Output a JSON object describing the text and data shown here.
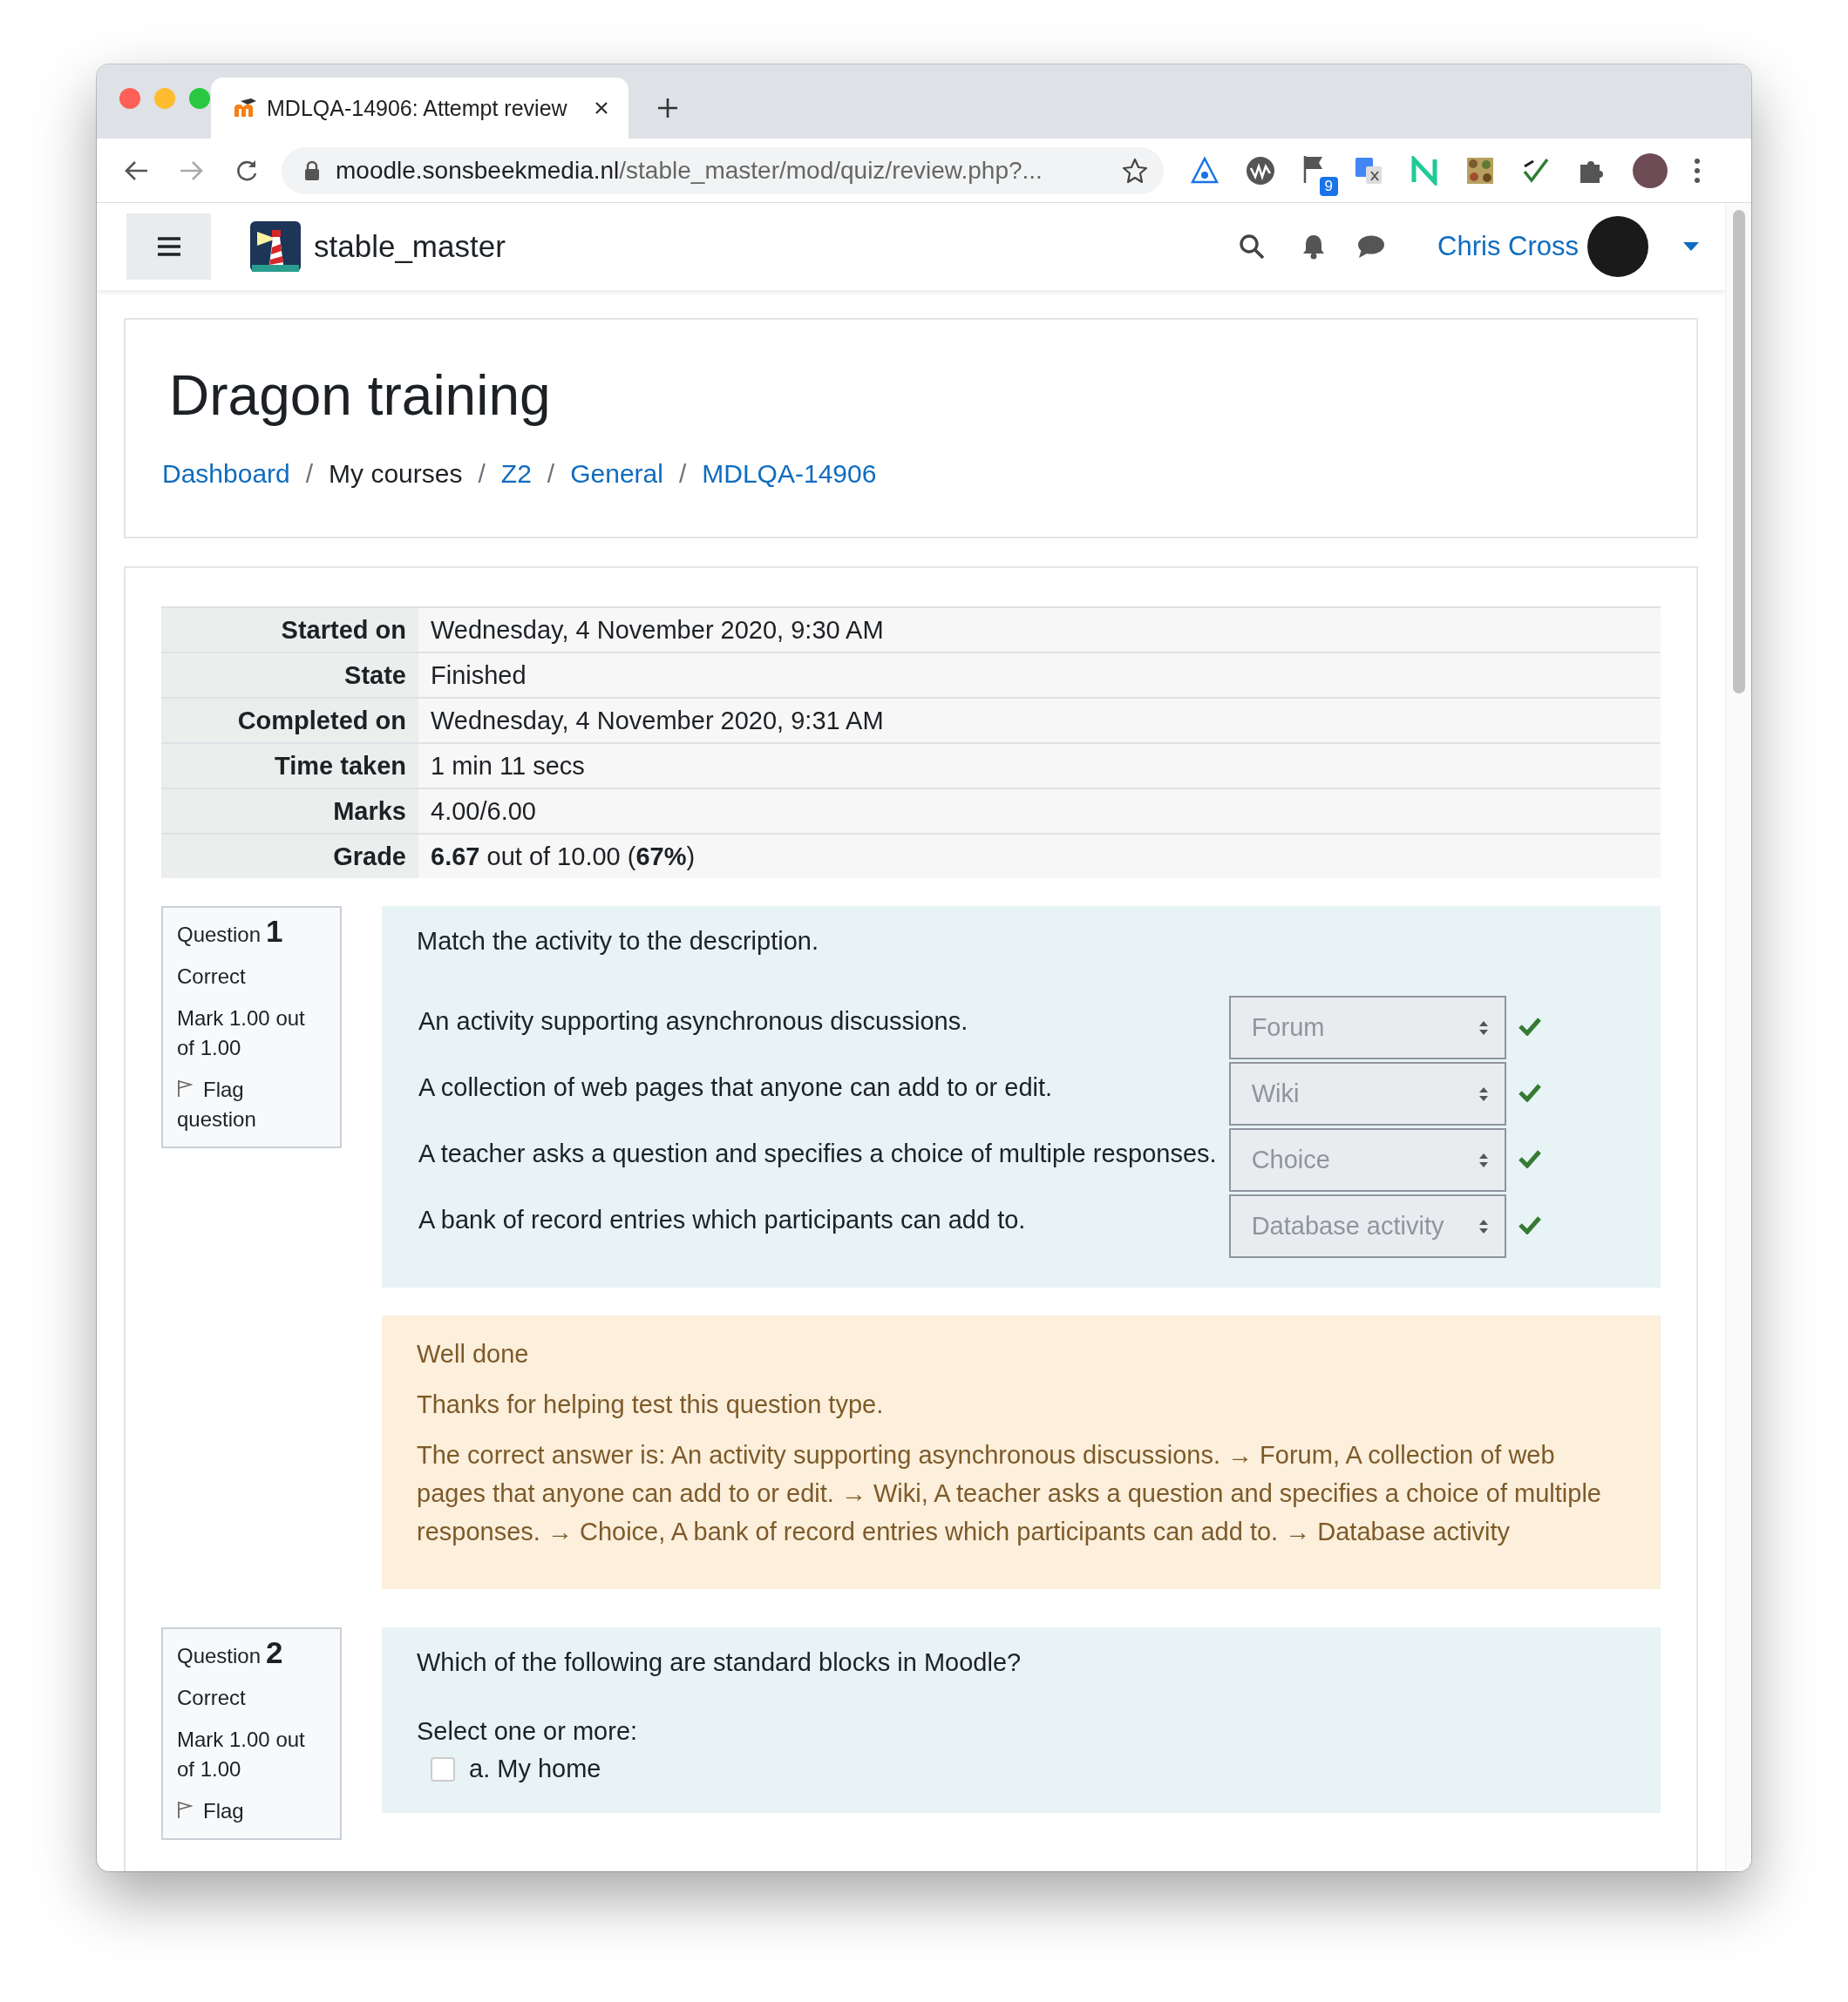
{
  "browser": {
    "tab": {
      "title": "MDLQA-14906: Attempt review",
      "selected": true
    },
    "address": {
      "domain": "moodle.sonsbeekmedia.nl",
      "path": "/stable_master/mod/quiz/review.php?..."
    },
    "extension_badge": "9"
  },
  "navbar": {
    "site_name": "stable_master",
    "user_name": "Chris Cross"
  },
  "page_title": "Dragon training",
  "breadcrumbs": [
    {
      "label": "Dashboard",
      "link": true
    },
    {
      "label": "My courses",
      "link": false
    },
    {
      "label": "Z2",
      "link": true
    },
    {
      "label": "General",
      "link": true
    },
    {
      "label": "MDLQA-14906",
      "link": true
    }
  ],
  "breadcrumb_separator": "/",
  "summary": [
    {
      "label": "Started on",
      "value": "Wednesday, 4 November 2020, 9:30 AM"
    },
    {
      "label": "State",
      "value": "Finished"
    },
    {
      "label": "Completed on",
      "value": "Wednesday, 4 November 2020, 9:31 AM"
    },
    {
      "label": "Time taken",
      "value": "1 min 11 secs"
    },
    {
      "label": "Marks",
      "value": "4.00/6.00"
    },
    {
      "label": "Grade",
      "value": "**6.67** out of 10.00 (**67%**)"
    }
  ],
  "questions": [
    {
      "kind": "match",
      "label": "Question",
      "number": "1",
      "state": "Correct",
      "mark": "Mark 1.00 out of 1.00",
      "flag": "Flag question",
      "prompt": "Match the activity to the description.",
      "rows": [
        {
          "text": "An activity supporting asynchronous discussions.",
          "answer": "Forum",
          "correct": true
        },
        {
          "text": "A collection of web pages that anyone can add to or edit.",
          "answer": "Wiki",
          "correct": true
        },
        {
          "text": "A teacher asks a question and specifies a choice of multiple responses.",
          "answer": "Choice",
          "correct": true
        },
        {
          "text": "A bank of record entries which participants can add to.",
          "answer": "Database activity",
          "correct": true
        }
      ],
      "feedback": [
        "Well done",
        "Thanks for helping test this question type.",
        "The correct answer is: An activity supporting asynchronous discussions. → Forum, A collection of web pages that anyone can add to or edit. → Wiki, A teacher asks a question and specifies a choice of multiple responses. → Choice, A bank of record entries which participants can add to. → Database activity"
      ]
    },
    {
      "kind": "multichoice",
      "label": "Question",
      "number": "2",
      "state": "Correct",
      "mark": "Mark 1.00 out of 1.00",
      "flag": "Flag",
      "prompt": "Which of the following are standard blocks in Moodle?",
      "instruction": "Select one or more:",
      "options": [
        {
          "label": "a. My home",
          "checked": false
        }
      ]
    }
  ]
}
